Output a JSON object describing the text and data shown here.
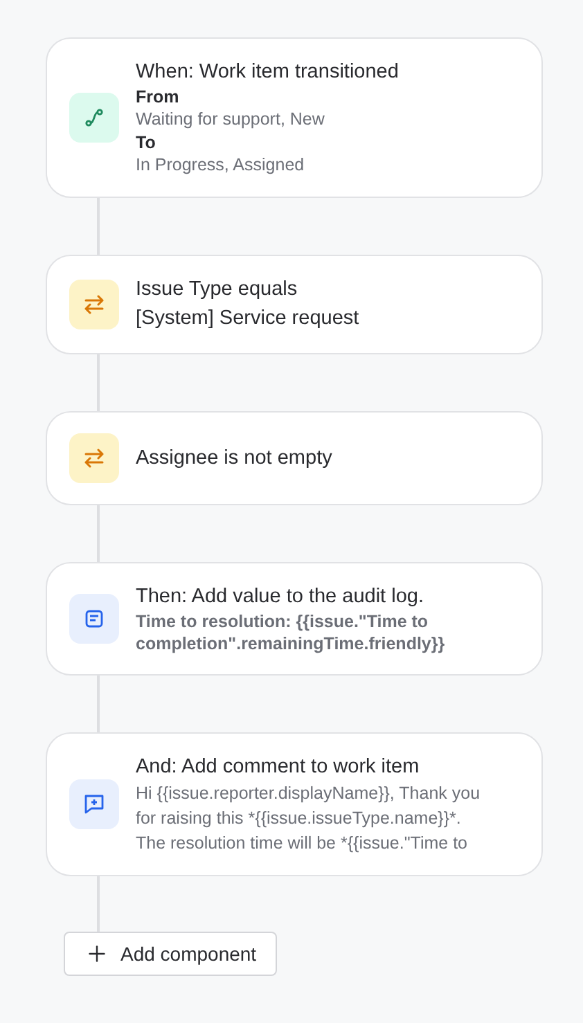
{
  "steps": [
    {
      "kind": "trigger",
      "title": "When: Work item transitioned",
      "lines": [
        {
          "kind": "heading",
          "text": "From"
        },
        {
          "kind": "detail",
          "text": "Waiting for support, New"
        },
        {
          "kind": "heading",
          "text": "To"
        },
        {
          "kind": "detail",
          "text": "In Progress, Assigned"
        }
      ]
    },
    {
      "kind": "condition",
      "title": "Issue Type equals",
      "lines": [
        {
          "kind": "plain",
          "text": "[System] Service request"
        }
      ]
    },
    {
      "kind": "condition",
      "title": "Assignee is not empty"
    },
    {
      "kind": "log",
      "title": "Then: Add value to the audit log.",
      "lines": [
        {
          "kind": "strong",
          "text": "Time to resolution: {{issue.\"Time to completion\".remainingTime.friendly}}"
        }
      ]
    },
    {
      "kind": "comment",
      "title": "And: Add comment to work item",
      "lines": [
        {
          "kind": "detail",
          "text": "Hi {{issue.reporter.displayName}}, Thank you for raising this *{{issue.issueType.name}}*. The resolution time will be *{{issue.\"Time to"
        }
      ]
    }
  ],
  "add_button": "Add component"
}
